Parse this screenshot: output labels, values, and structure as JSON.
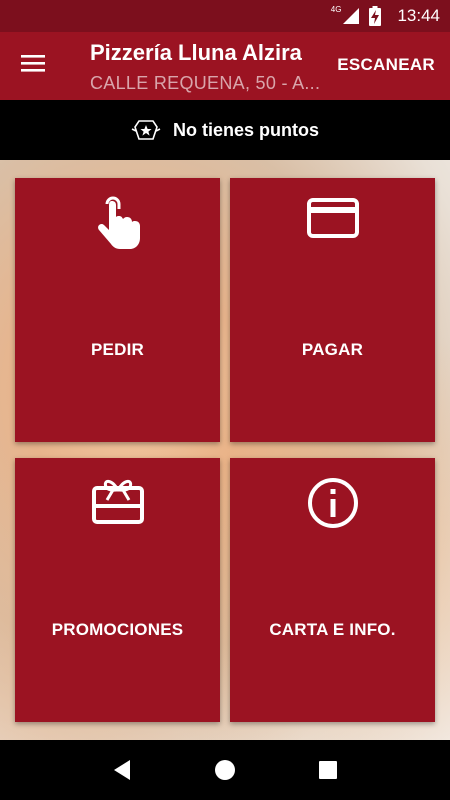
{
  "status_bar": {
    "network_type": "4G",
    "time": "13:44",
    "icons": [
      "signal-icon",
      "battery-charging-icon"
    ]
  },
  "app_bar": {
    "title": "Pizzería Lluna Alzira",
    "subtitle": "CALLE REQUENA, 50 - A...",
    "scan_label": "ESCANEAR",
    "menu_icon": "hamburger-menu-icon"
  },
  "points": {
    "text": "No tienes puntos",
    "icon": "points-badge-icon"
  },
  "tiles": [
    {
      "label": "PEDIR",
      "icon": "tap-finger-icon"
    },
    {
      "label": "PAGAR",
      "icon": "credit-card-icon"
    },
    {
      "label": "PROMOCIONES",
      "icon": "gift-card-icon"
    },
    {
      "label": "CARTA E INFO.",
      "icon": "info-circle-icon"
    }
  ],
  "nav_bar": {
    "icons": [
      "back-icon",
      "home-icon",
      "recents-icon"
    ]
  },
  "colors": {
    "primary": "#9b1322",
    "status_bar": "#7c0f1d",
    "points_bar": "#000000"
  }
}
